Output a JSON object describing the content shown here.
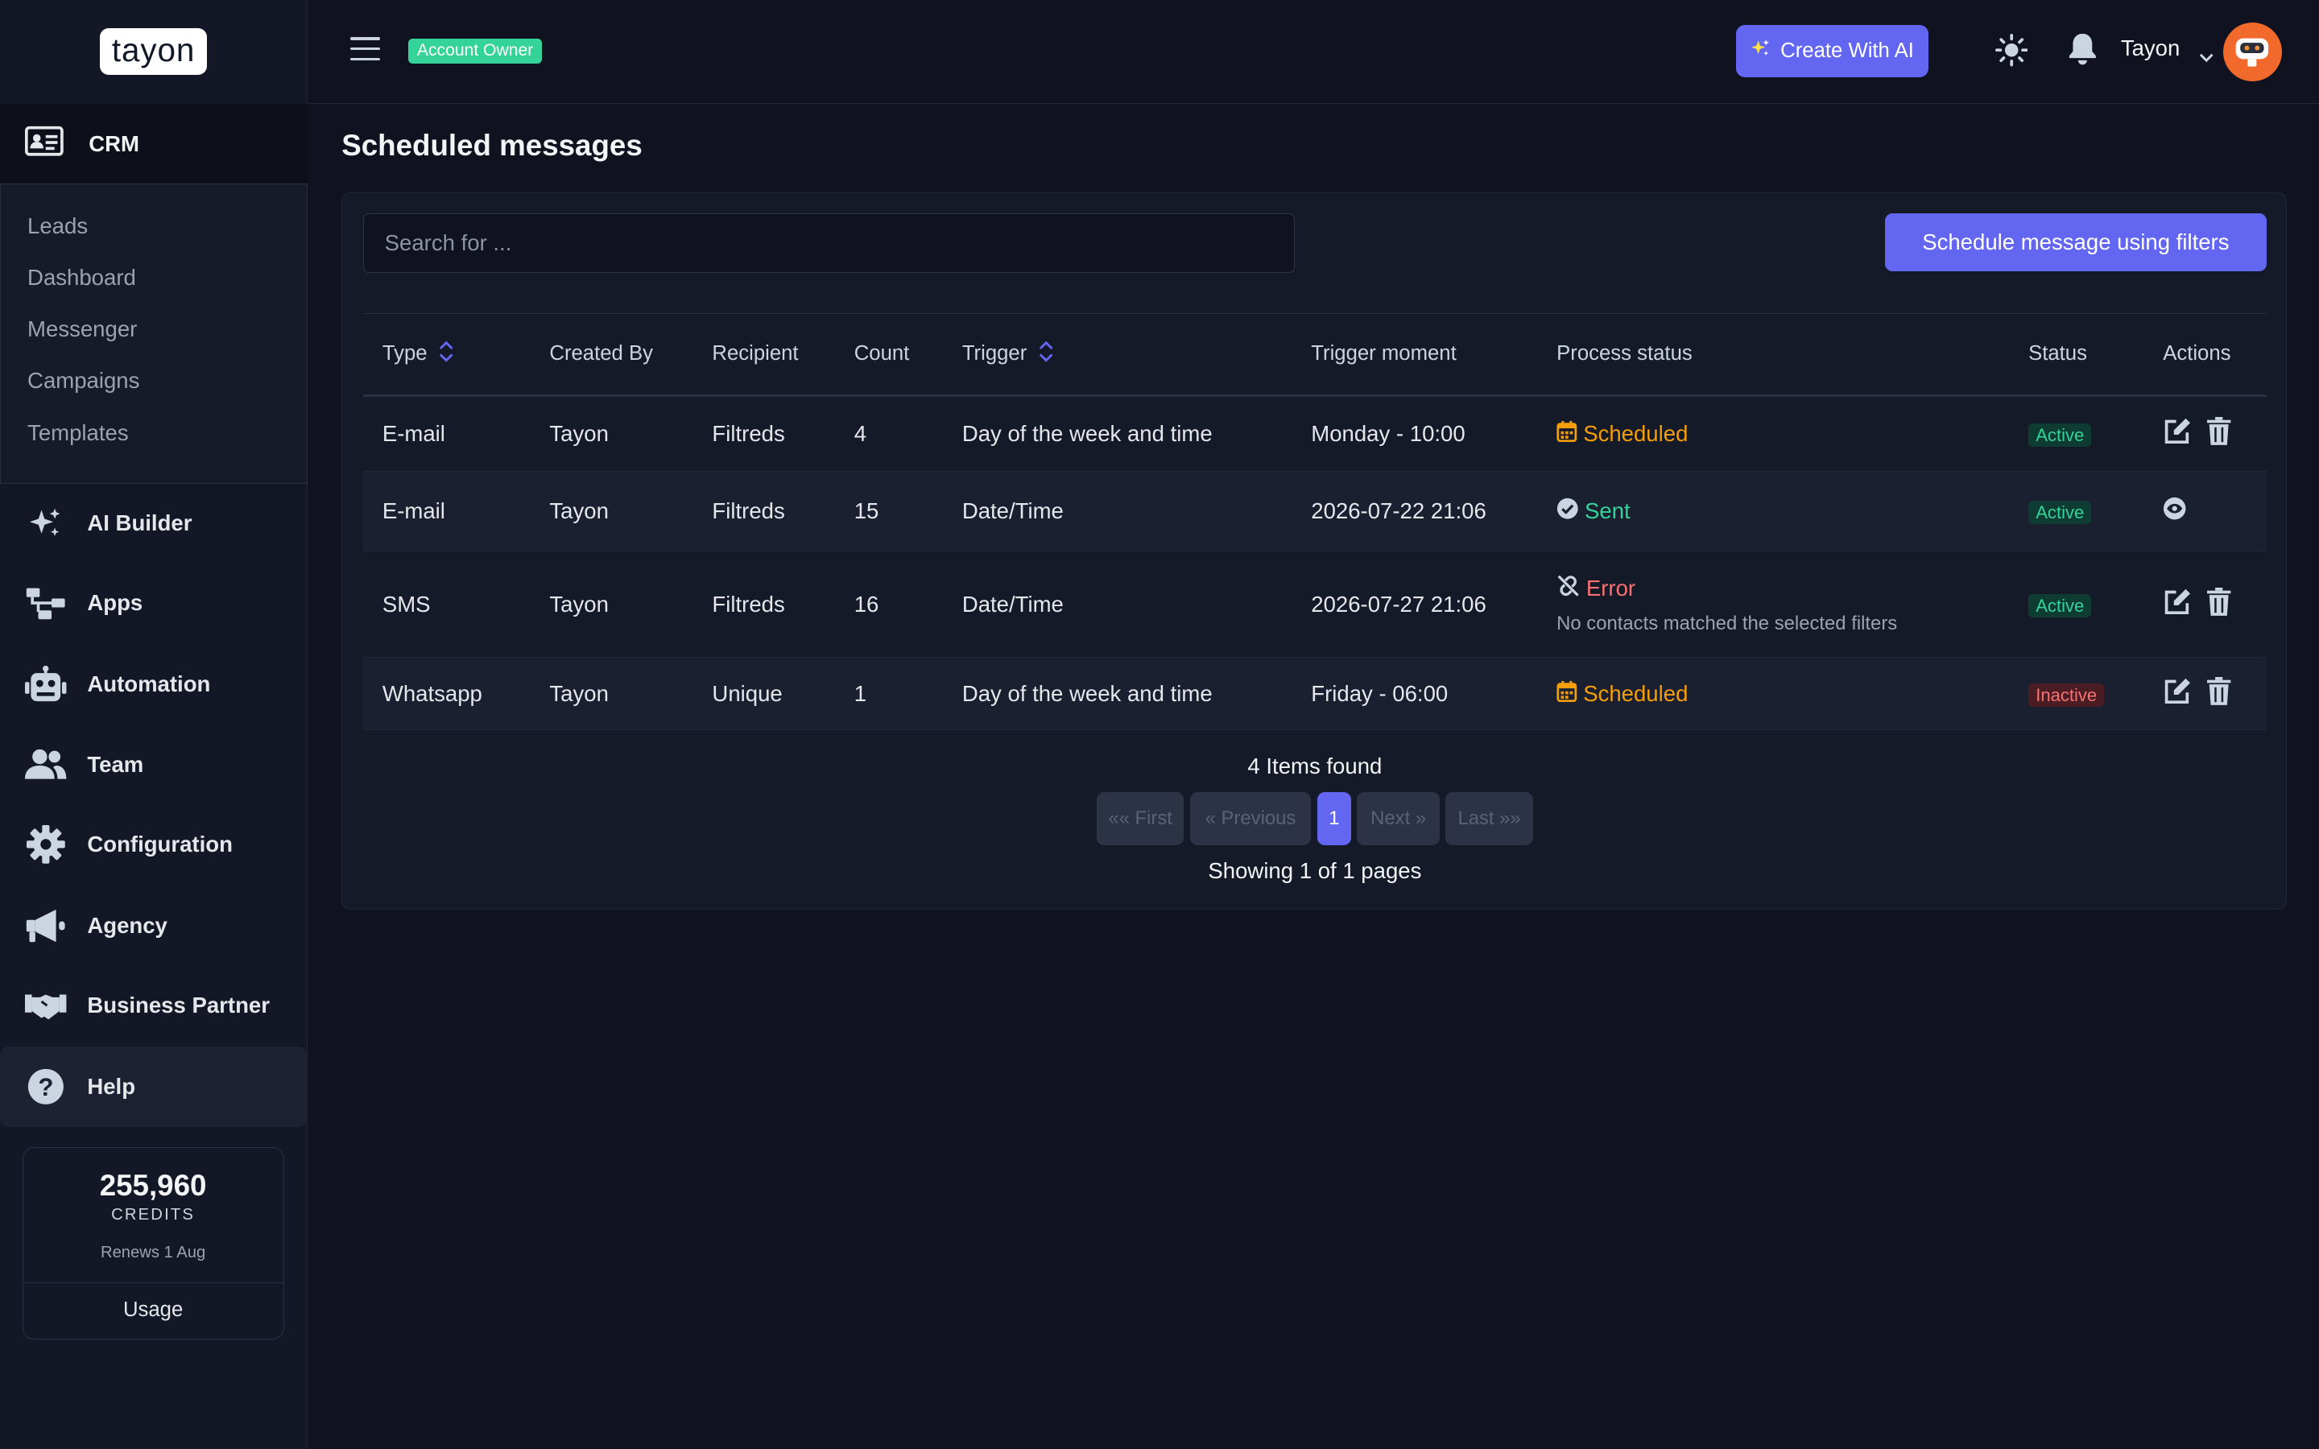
{
  "brand": {
    "logo_text": "tayon"
  },
  "sidebar": {
    "crm_label": "CRM",
    "submenu": [
      "Leads",
      "Dashboard",
      "Messenger",
      "Campaigns",
      "Templates"
    ],
    "items": [
      {
        "label": "AI Builder",
        "icon": "sparkles-icon"
      },
      {
        "label": "Apps",
        "icon": "sitemap-icon"
      },
      {
        "label": "Automation",
        "icon": "robot-icon"
      },
      {
        "label": "Team",
        "icon": "users-icon"
      },
      {
        "label": "Configuration",
        "icon": "gear-icon"
      },
      {
        "label": "Agency",
        "icon": "megaphone-icon"
      },
      {
        "label": "Business Partner",
        "icon": "handshake-icon"
      },
      {
        "label": "Help",
        "icon": "question-icon"
      }
    ],
    "credits": {
      "amount": "255,960",
      "label": "CREDITS",
      "renews": "Renews 1 Aug",
      "usage_label": "Usage"
    }
  },
  "topbar": {
    "role_badge": "Account Owner",
    "create_ai_label": "Create With AI",
    "user_name": "Tayon"
  },
  "page": {
    "title": "Scheduled messages",
    "search_placeholder": "Search for ...",
    "schedule_button": "Schedule message using filters",
    "columns": [
      "Type",
      "Created By",
      "Recipient",
      "Count",
      "Trigger",
      "Trigger moment",
      "Process status",
      "Status",
      "Actions"
    ],
    "rows": [
      {
        "type": "E-mail",
        "created_by": "Tayon",
        "recipient": "Filtreds",
        "count": "4",
        "trigger": "Day of the week and time",
        "moment": "Monday - 10:00",
        "process": "Scheduled",
        "note": "",
        "status": "Active"
      },
      {
        "type": "E-mail",
        "created_by": "Tayon",
        "recipient": "Filtreds",
        "count": "15",
        "trigger": "Date/Time",
        "moment": "2026-07-22 21:06",
        "process": "Sent",
        "note": "",
        "status": "Active"
      },
      {
        "type": "SMS",
        "created_by": "Tayon",
        "recipient": "Filtreds",
        "count": "16",
        "trigger": "Date/Time",
        "moment": "2026-07-27 21:06",
        "process": "Error",
        "note": "No contacts matched the selected filters",
        "status": "Active"
      },
      {
        "type": "Whatsapp",
        "created_by": "Tayon",
        "recipient": "Unique",
        "count": "1",
        "trigger": "Day of the week and time",
        "moment": "Friday - 06:00",
        "process": "Scheduled",
        "note": "",
        "status": "Inactive"
      }
    ],
    "items_found": "4 Items found",
    "pagination": {
      "first": "«« First",
      "previous": "« Previous",
      "current": "1",
      "next": "Next »",
      "last": "Last »»"
    },
    "showing": "Showing 1 of 1 pages"
  },
  "colors": {
    "accent": "#6366f1",
    "success": "#34d399",
    "warning": "#f59e0b",
    "danger": "#f87171",
    "background": "#10131f"
  }
}
